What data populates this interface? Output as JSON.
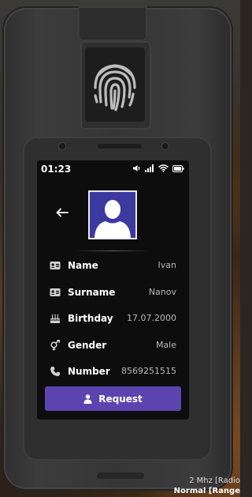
{
  "status_bar": {
    "time": "01:23",
    "icons": [
      "volume-icon",
      "signal-icon",
      "wifi-icon",
      "battery-icon"
    ]
  },
  "profile": {
    "back_icon": "arrow-left-icon",
    "avatar_icon": "user-silhouette-icon",
    "fields": [
      {
        "icon": "id-card-icon",
        "label": "Name",
        "value": "Ivan"
      },
      {
        "icon": "id-card-icon",
        "label": "Surname",
        "value": "Nanov"
      },
      {
        "icon": "birthday-cake-icon",
        "label": "Birthday",
        "value": "17.07.2000"
      },
      {
        "icon": "gender-icon",
        "label": "Gender",
        "value": "Male"
      },
      {
        "icon": "phone-icon",
        "label": "Number",
        "value": "8569251515"
      }
    ],
    "request_label": "Request",
    "request_icon": "user-icon"
  },
  "hud": {
    "radio_line": "2 Mhz [Radio",
    "mode_line": "Normal [Range"
  },
  "colors": {
    "accent": "#5b44b0",
    "avatar_bg": "#3c3aa0",
    "screen_bg": "#0d0d0d",
    "device_body": "#363636"
  }
}
